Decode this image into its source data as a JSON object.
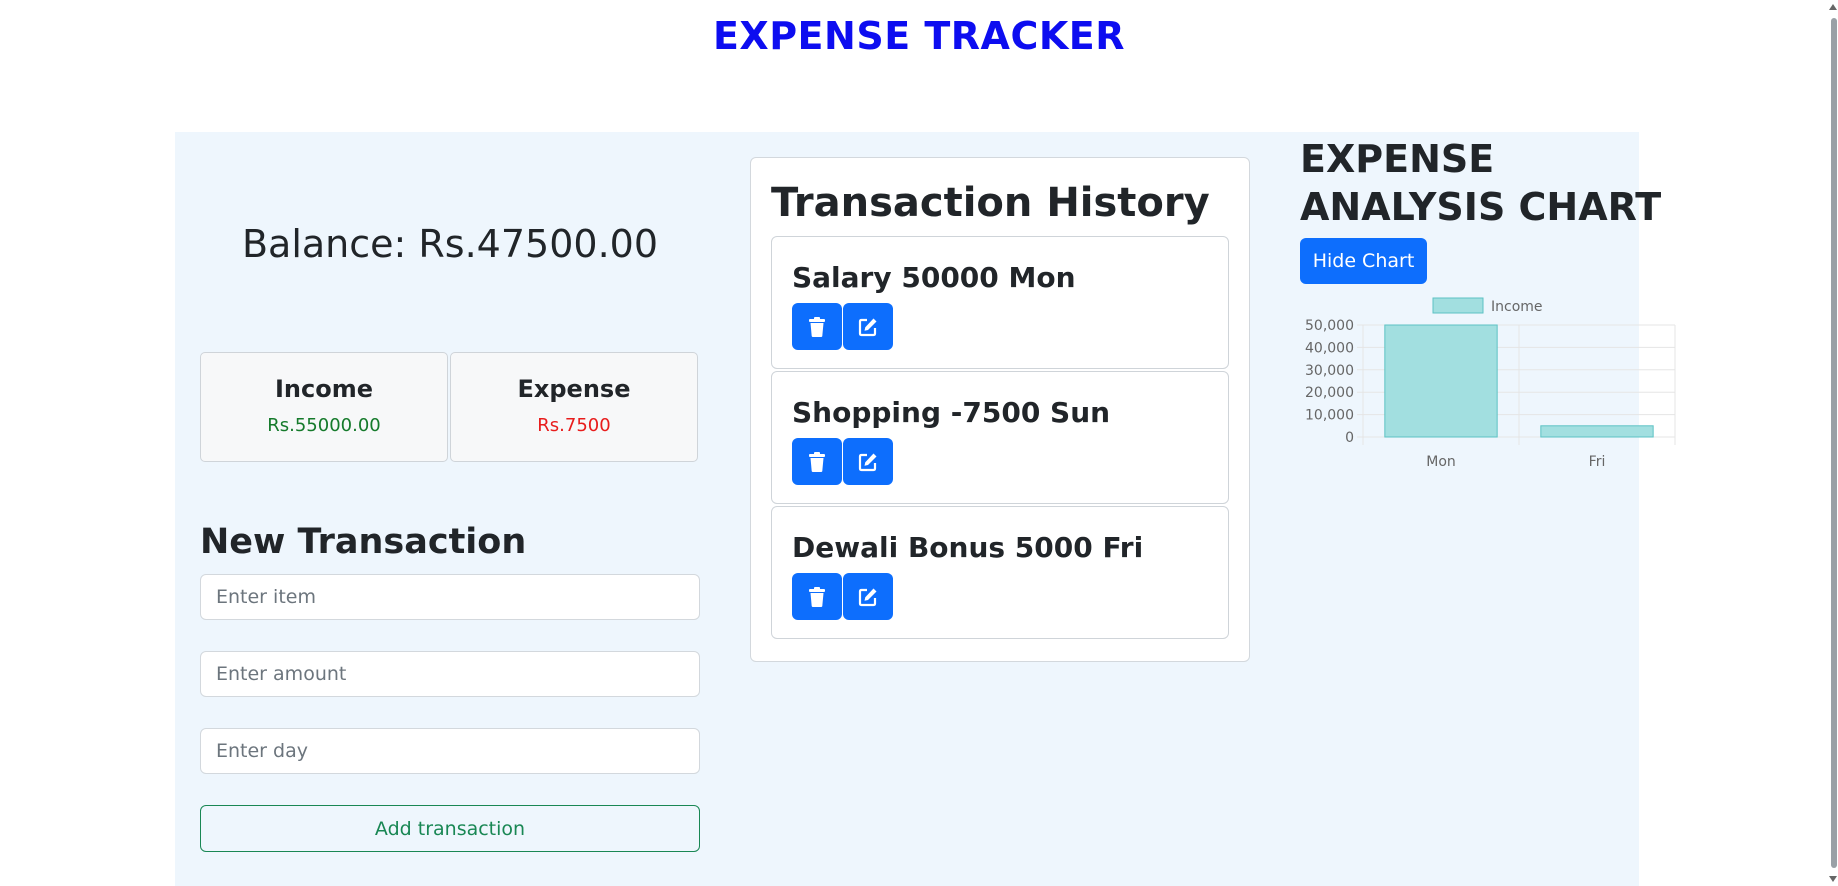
{
  "app": {
    "title": "EXPENSE TRACKER"
  },
  "summary": {
    "balance": "Balance: Rs.47500.00",
    "income_label": "Income",
    "income_value": "Rs.55000.00",
    "expense_label": "Expense",
    "expense_value": "Rs.7500",
    "income_color": "#157a2b",
    "expense_color": "#e81c1c"
  },
  "form": {
    "title": "New Transaction",
    "item_placeholder": "Enter item",
    "amount_placeholder": "Enter amount",
    "day_placeholder": "Enter day",
    "add_label": "Add transaction"
  },
  "history": {
    "title": "Transaction History",
    "items": [
      {
        "text": "Salary 50000 Mon",
        "delete_icon": "trash-icon",
        "edit_icon": "edit-icon"
      },
      {
        "text": "Shopping -7500 Sun",
        "delete_icon": "trash-icon",
        "edit_icon": "edit-icon"
      },
      {
        "text": "Dewali Bonus 5000 Fri",
        "delete_icon": "trash-icon",
        "edit_icon": "edit-icon"
      }
    ]
  },
  "analysis": {
    "title": "EXPENSE ANALYSIS CHART",
    "hide_label": "Hide Chart"
  },
  "colors": {
    "accent": "#0d6efd",
    "title": "#0d0df0",
    "panel_bg": "#eef6fd",
    "success": "#198754",
    "bar_fill": "#a2dfe0",
    "bar_stroke": "#5cc2c4"
  },
  "chart_data": {
    "type": "bar",
    "categories": [
      "Mon",
      "Fri"
    ],
    "series": [
      {
        "name": "Income",
        "values": [
          50000,
          5000
        ]
      }
    ],
    "ylim": [
      0,
      50000
    ],
    "yticks": [
      "50,000",
      "40,000",
      "30,000",
      "20,000",
      "10,000",
      "0"
    ],
    "legend": "top",
    "grid": true
  }
}
